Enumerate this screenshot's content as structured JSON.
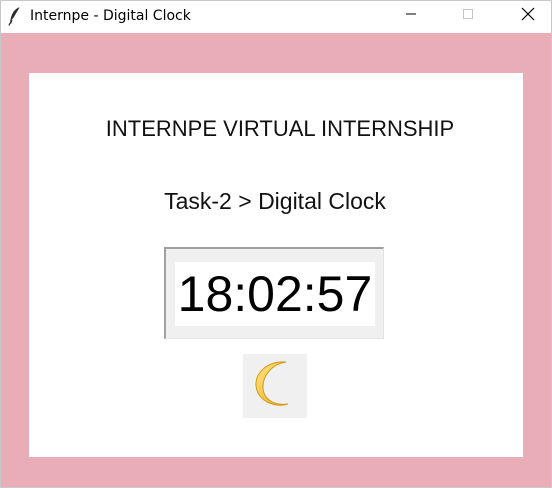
{
  "window": {
    "title": "Internpe - Digital Clock",
    "app_icon": "feather-icon",
    "controls": {
      "minimize_icon": "minimize-icon",
      "maximize_icon": "maximize-icon",
      "close_icon": "close-icon"
    }
  },
  "content": {
    "heading": "INTERNPE VIRTUAL INTERNSHIP",
    "subheading": "Task-2 > Digital Clock",
    "clock_time": "18:02:57",
    "theme_toggle_icon": "crescent-moon-icon"
  },
  "colors": {
    "frame_background": "#e9adb8",
    "panel_background": "#ffffff",
    "text": "#111111",
    "moon": "#f5c636"
  }
}
